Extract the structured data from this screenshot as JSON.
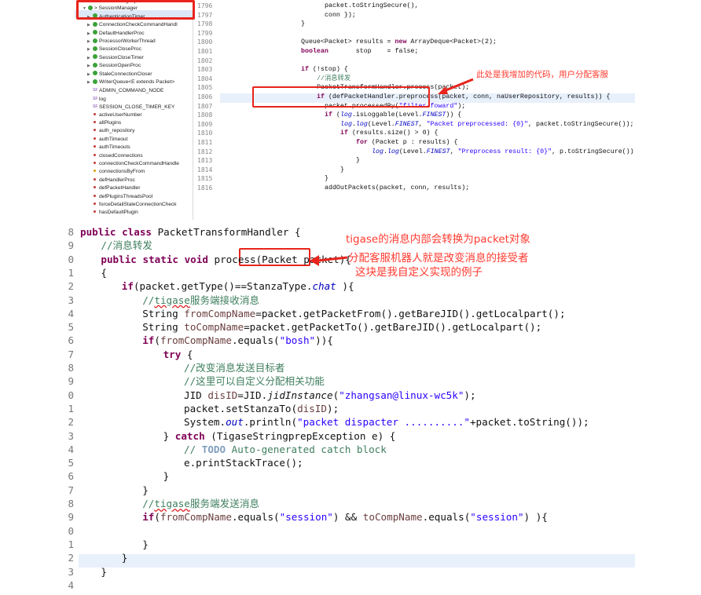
{
  "outline": {
    "items": [
      {
        "label": "SessionManager.java",
        "icon": "java-file-icon",
        "indent": 0
      },
      {
        "label": "SessionManager",
        "icon": "class-icon",
        "indent": 1
      },
      {
        "label": "AuthenticationTimer",
        "icon": "class-icon",
        "indent": 2
      },
      {
        "label": "ConnectionCheckCommandHandl",
        "icon": "class-icon",
        "indent": 2
      },
      {
        "label": "DefaultHandlerProc",
        "icon": "class-icon",
        "indent": 2
      },
      {
        "label": "ProcessorWorkerThread",
        "icon": "class-icon",
        "indent": 2
      },
      {
        "label": "SessionCloseProc",
        "icon": "class-icon",
        "indent": 2
      },
      {
        "label": "SessionCloseTimer",
        "icon": "class-icon",
        "indent": 2
      },
      {
        "label": "SessionOpenProc",
        "icon": "class-icon",
        "indent": 2
      },
      {
        "label": "StaleConnectionCloser",
        "icon": "class-icon",
        "indent": 2
      },
      {
        "label": "WriterQueue<E extends Packet>",
        "icon": "class-icon",
        "indent": 2
      },
      {
        "label": "ADMIN_COMMAND_NODE",
        "icon": "static-final-field-icon",
        "indent": 2
      },
      {
        "label": "log",
        "icon": "static-final-field-icon",
        "indent": 2
      },
      {
        "label": "SESSION_CLOSE_TIMER_KEY",
        "icon": "static-final-field-icon",
        "indent": 2
      },
      {
        "label": "activeUserNumber",
        "icon": "private-field-icon",
        "indent": 2
      },
      {
        "label": "allPlugins",
        "icon": "private-field-icon",
        "indent": 2
      },
      {
        "label": "auth_repository",
        "icon": "private-field-icon",
        "indent": 2
      },
      {
        "label": "authTimeout",
        "icon": "private-field-icon",
        "indent": 2
      },
      {
        "label": "authTimeouts",
        "icon": "private-field-icon",
        "indent": 2
      },
      {
        "label": "closedConnections",
        "icon": "private-field-icon",
        "indent": 2
      },
      {
        "label": "connectionCheckCommandHandle",
        "icon": "private-field-icon",
        "indent": 2
      },
      {
        "label": "connectionsByFrom",
        "icon": "protected-field-icon",
        "indent": 2
      },
      {
        "label": "defHandlerProc",
        "icon": "private-field-icon",
        "indent": 2
      },
      {
        "label": "defPacketHandler",
        "icon": "private-field-icon",
        "indent": 2
      },
      {
        "label": "defPluginsThreadsPool",
        "icon": "private-field-icon",
        "indent": 2
      },
      {
        "label": "forceDetailStaleConnectionCheck",
        "icon": "private-field-icon",
        "indent": 2
      },
      {
        "label": "hasDefaultPlugin",
        "icon": "private-field-icon",
        "indent": 2
      }
    ]
  },
  "top_editor": {
    "line_numbers": [
      "1796",
      "1797",
      "1798",
      "1799",
      "1800",
      "1801",
      "1802",
      "1803",
      "1804",
      "1805",
      "1806",
      "1807",
      "1808",
      "1809",
      "1810",
      "1811",
      "1812",
      "1813",
      "1814",
      "1815",
      "1816"
    ],
    "lines": [
      "packet.toStringSecure(),",
      "conn });",
      "}",
      "",
      "Queue<Packet> results = new ArrayDeque<Packet>(2);",
      "boolean       stop    = false;",
      "",
      "if (!stop) {",
      "//消息转发",
      "PacketTransformHandler.process(packet);",
      "if (defPacketHandler.preprocess(packet, conn, naUserRepository, results)) {",
      "packet.processedBy(\"filter-foward\");",
      "if (log.isLoggable(Level.FINEST)) {",
      "log.log(Level.FINEST, \"Packet preprocessed: {0}\", packet.toStringSecure());",
      "if (results.size() > 0) {",
      "for (Packet p : results) {",
      "log.log(Level.FINEST, \"Preprocess result: {0}\", p.toStringSecure());",
      "}",
      "}",
      "}",
      "addOutPackets(packet, conn, results);"
    ],
    "annotation": "此处是我增加的代码，用户分配客服"
  },
  "bottom_editor": {
    "line_numbers": [
      "8",
      "9",
      "0",
      "1",
      "2",
      "3",
      "4",
      "5",
      "6",
      "7",
      "8",
      "9",
      "0",
      "1",
      "2",
      "3",
      "4",
      "5",
      "6",
      "7",
      "8",
      "9",
      "0",
      "1",
      "2",
      "3",
      "4"
    ],
    "lines": [
      "public class PacketTransformHandler {",
      "//消息转发",
      "public static void process(Packet packet){",
      "{",
      "if(packet.getType()==StanzaType.chat ){",
      "//tigase服务端接收消息",
      "String fromCompName=packet.getPacketFrom().getBareJID().getLocalpart();",
      "String toCompName=packet.getPacketTo().getBareJID().getLocalpart();",
      "if(fromCompName.equals(\"bosh\")){",
      "try {",
      "//改变消息发送目标者",
      "//这里可以自定义分配相关功能",
      "JID disID=JID.jidInstance(\"zhangsan@linux-wc5k\");",
      "packet.setStanzaTo(disID);",
      "System.out.println(\"packet dispacter ..........\"+packet.toString());",
      "} catch (TigaseStringprepException e) {",
      "// TODO Auto-generated catch block",
      "e.printStackTrace();",
      "}",
      "}",
      "//tigase服务端发送消息",
      "if(fromCompName.equals(\"session\") && toCompName.equals(\"session\") ){",
      "",
      "}",
      "}",
      "}",
      ""
    ],
    "annotations": {
      "line1": "tigase的消息内部会转换为packet对象",
      "line2": "分配客服机器人就是改变消息的接受者",
      "line3": "这块是我自定义实现的例子"
    }
  },
  "colors": {
    "keyword": "#7f0055",
    "comment": "#3f7f5f",
    "string": "#2a00ff",
    "field": "#0000c0",
    "annotation": "#ff3b30",
    "highlight_box": "#e8241c"
  }
}
